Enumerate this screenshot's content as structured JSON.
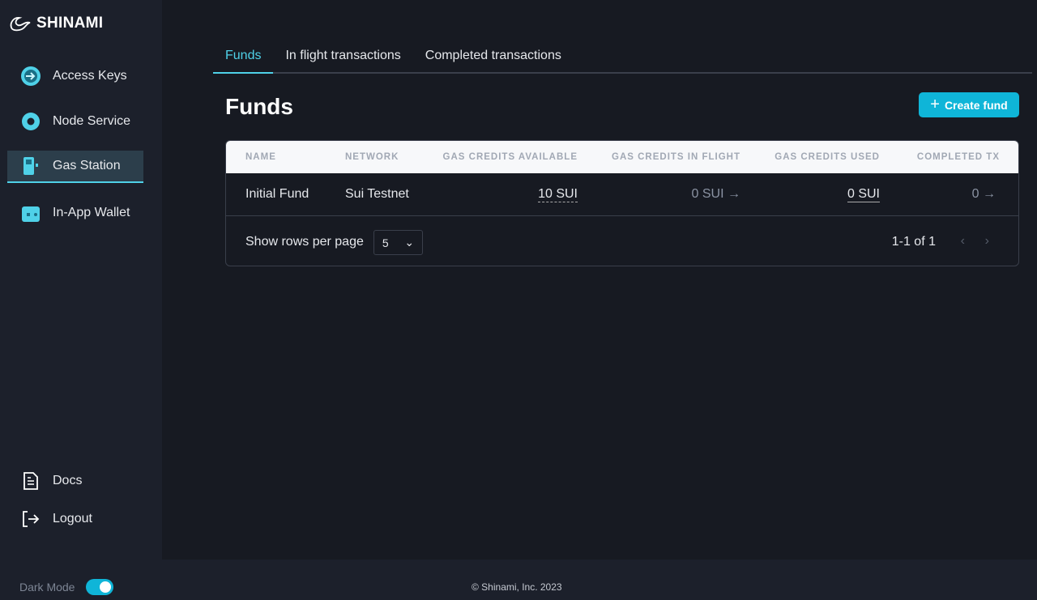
{
  "brand": {
    "name": "SHINAMI"
  },
  "sidebar": {
    "items": [
      {
        "label": "Access Keys",
        "icon": "key-circle-icon"
      },
      {
        "label": "Node Service",
        "icon": "node-icon"
      },
      {
        "label": "Gas Station",
        "icon": "gas-pump-icon",
        "active": true
      },
      {
        "label": "In-App Wallet",
        "icon": "wallet-icon"
      }
    ],
    "bottom": [
      {
        "label": "Docs",
        "icon": "document-icon"
      },
      {
        "label": "Logout",
        "icon": "logout-icon"
      }
    ],
    "dark_mode_label": "Dark Mode",
    "dark_mode_on": true
  },
  "tabs": [
    {
      "label": "Funds",
      "active": true
    },
    {
      "label": "In flight transactions"
    },
    {
      "label": "Completed transactions"
    }
  ],
  "page_title": "Funds",
  "create_button": "Create fund",
  "table": {
    "headers": [
      "NAME",
      "NETWORK",
      "GAS CREDITS AVAILABLE",
      "GAS CREDITS IN FLIGHT",
      "GAS CREDITS USED",
      "COMPLETED TX"
    ],
    "rows": [
      {
        "name": "Initial Fund",
        "network": "Sui Testnet",
        "available": "10 SUI",
        "in_flight": "0 SUI",
        "used": "0 SUI",
        "completed": "0"
      }
    ]
  },
  "pagination": {
    "rows_label": "Show rows per page",
    "rows_value": "5",
    "range": "1-1 of 1"
  },
  "footer": {
    "copyright": "© Shinami, Inc. 2023"
  },
  "colors": {
    "accent": "#0fb5d8",
    "sidebar": "#1c202b",
    "main": "#171a22"
  }
}
